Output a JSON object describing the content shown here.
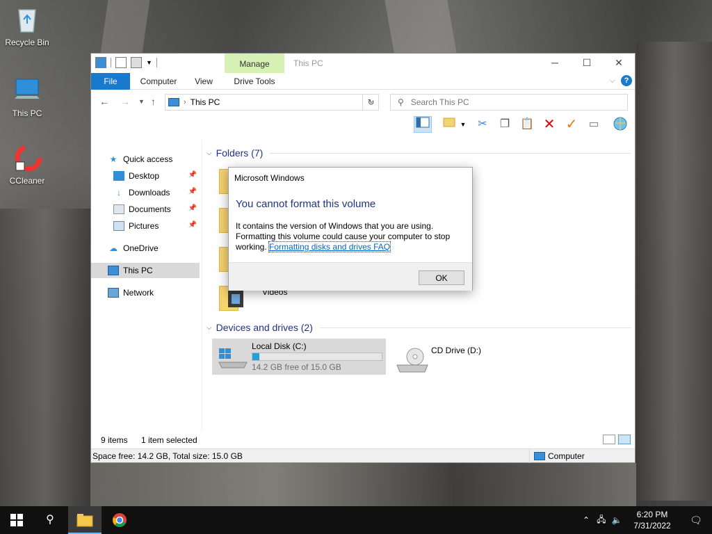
{
  "desktop": {
    "icons": [
      {
        "label": "Recycle Bin"
      },
      {
        "label": "This PC"
      },
      {
        "label": "CCleaner"
      }
    ]
  },
  "window": {
    "title": "This PC",
    "contextual_tab": "Manage",
    "ribbon_tabs": {
      "file": "File",
      "computer": "Computer",
      "view": "View",
      "drive_tools": "Drive Tools"
    },
    "address": {
      "path": "This PC"
    },
    "search": {
      "placeholder": "Search This PC"
    },
    "nav": {
      "quick_access": "Quick access",
      "desktop": "Desktop",
      "downloads": "Downloads",
      "documents": "Documents",
      "pictures": "Pictures",
      "onedrive": "OneDrive",
      "this_pc": "This PC",
      "network": "Network"
    },
    "groups": {
      "folders": "Folders (7)",
      "devices": "Devices and drives (2)"
    },
    "folders_visible": {
      "videos": "Videos"
    },
    "drives": [
      {
        "name": "Local Disk (C:)",
        "free": "14.2 GB free of 15.0 GB",
        "used_fraction": 0.053
      },
      {
        "name": "CD Drive (D:)"
      }
    ],
    "status": {
      "items": "9 items",
      "selected": "1 item selected"
    },
    "details": {
      "space": "Space free: 14.2 GB, Total size: 15.0 GB",
      "location": "Computer"
    }
  },
  "dialog": {
    "title": "Microsoft Windows",
    "heading": "You cannot format this volume",
    "body": "It contains the version of Windows that you are using. Formatting this volume could cause your computer to stop working.",
    "link": "Formatting disks and drives FAQ",
    "ok_label": "OK"
  },
  "taskbar": {
    "time": "6:20 PM",
    "date": "7/31/2022"
  },
  "colors": {
    "accent": "#1979ca",
    "manage_tab": "#d7f0b3",
    "heading_blue": "#1e3287",
    "drive_fill": "#26a0da"
  }
}
